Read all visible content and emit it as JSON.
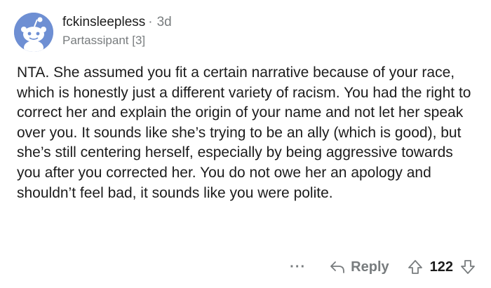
{
  "comment": {
    "username": "fckinsleepless",
    "separator": "·",
    "age": "3d",
    "flair": "Partassipant [3]",
    "body": "NTA. She assumed you fit a certain narrative because of your race, which is honestly just a different variety of racism. You had the right to correct her and explain the origin of your name and not let her speak over you. It sounds like she’s trying to be an ally (which is good), but she’s still centering herself, especially by being aggressive towards you after you corrected her. You do not owe her an apology and shouldn’t feel bad, it sounds like you were polite."
  },
  "actions": {
    "more_label": "···",
    "reply_label": "Reply",
    "score": "122"
  },
  "icons": {
    "avatar": "snoo-avatar-icon",
    "reply": "reply-arrow-icon",
    "upvote": "upvote-arrow-icon",
    "downvote": "downvote-arrow-icon"
  },
  "colors": {
    "avatar_bg": "#6e8fd3",
    "meta_gray": "#787c7e",
    "text": "#1c1c1c"
  }
}
